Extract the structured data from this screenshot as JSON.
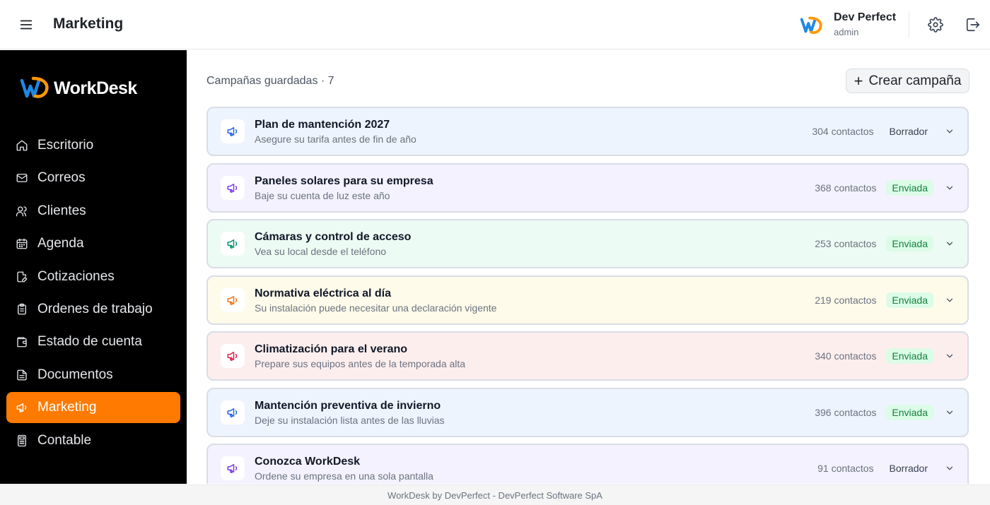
{
  "header": {
    "title": "Marketing",
    "user_name": "Dev Perfect",
    "user_role": "admin"
  },
  "brand": {
    "work": "Work",
    "desk": "Desk"
  },
  "sidebar": {
    "items": [
      {
        "label": "Escritorio",
        "icon": "home-icon"
      },
      {
        "label": "Correos",
        "icon": "mail-icon"
      },
      {
        "label": "Clientes",
        "icon": "users-icon"
      },
      {
        "label": "Agenda",
        "icon": "calendar-icon"
      },
      {
        "label": "Cotizaciones",
        "icon": "file-edit-icon"
      },
      {
        "label": "Ordenes de trabajo",
        "icon": "clipboard-icon"
      },
      {
        "label": "Estado de cuenta",
        "icon": "wallet-icon"
      },
      {
        "label": "Documentos",
        "icon": "document-icon"
      },
      {
        "label": "Marketing",
        "icon": "megaphone-icon"
      },
      {
        "label": "Contable",
        "icon": "calculator-icon"
      }
    ],
    "active": "Marketing",
    "accent_color": "#ff7a00"
  },
  "main": {
    "section_title": "Campañas guardadas · 7",
    "create_button": "Crear campaña",
    "campaigns": [
      {
        "title": "Plan de mantención 2027",
        "subtitle": "Asegure su tarifa antes de fin de año",
        "contacts": "304 contactos",
        "status": "Borrador",
        "status_type": "draft",
        "bg": "#eef4fe",
        "icon_color": "#2563eb"
      },
      {
        "title": "Paneles solares para su empresa",
        "subtitle": "Baje su cuenta de luz este año",
        "contacts": "368 contactos",
        "status": "Enviada",
        "status_type": "sent",
        "bg": "#f3f2fe",
        "icon_color": "#7c3aed"
      },
      {
        "title": "Cámaras y control de acceso",
        "subtitle": "Vea su local desde el teléfono",
        "contacts": "253 contactos",
        "status": "Enviada",
        "status_type": "sent",
        "bg": "#ecfbf3",
        "icon_color": "#059669"
      },
      {
        "title": "Normativa eléctrica al día",
        "subtitle": "Su instalación puede necesitar una declaración vigente",
        "contacts": "219 contactos",
        "status": "Enviada",
        "status_type": "sent",
        "bg": "#fefbea",
        "icon_color": "#f97316"
      },
      {
        "title": "Climatización para el verano",
        "subtitle": "Prepare sus equipos antes de la temporada alta",
        "contacts": "340 contactos",
        "status": "Enviada",
        "status_type": "sent",
        "bg": "#fdeeee",
        "icon_color": "#e11d48"
      },
      {
        "title": "Mantención preventiva de invierno",
        "subtitle": "Deje su instalación lista antes de las lluvias",
        "contacts": "396 contactos",
        "status": "Enviada",
        "status_type": "sent",
        "bg": "#eef4fe",
        "icon_color": "#2563eb"
      },
      {
        "title": "Conozca WorkDesk",
        "subtitle": "Ordene su empresa en una sola pantalla",
        "contacts": "91 contactos",
        "status": "Borrador",
        "status_type": "draft",
        "bg": "#f3f2fe",
        "icon_color": "#7c3aed"
      }
    ]
  },
  "footer": {
    "text": "WorkDesk by DevPerfect - DevPerfect Software SpA"
  }
}
